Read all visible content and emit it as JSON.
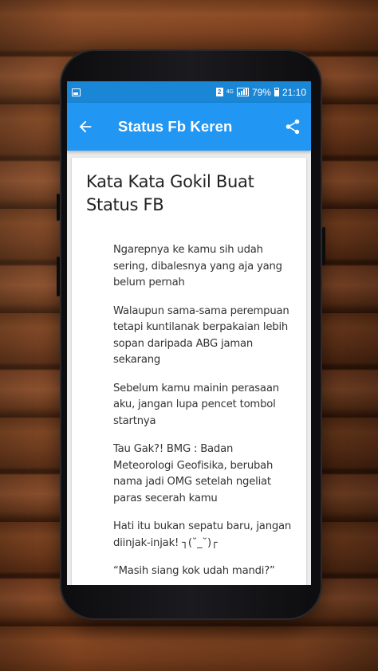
{
  "status_bar": {
    "gallery_icon": "image-icon",
    "sim_label": "2",
    "network_label": "4G",
    "battery_percent": "79%",
    "time": "21:10"
  },
  "app_bar": {
    "title": "Status Fb Keren",
    "back_icon": "arrow-back-icon",
    "share_icon": "share-icon"
  },
  "article": {
    "title": "Kata Kata Gokil Buat Status FB",
    "paragraphs": [
      "Ngarepnya ke kamu sih udah sering, dibalesnya yang aja yang belum pernah",
      "Walaupun sama-sama perempuan tetapi kuntilanak berpakaian lebih sopan daripada ABG jaman sekarang",
      "Sebelum kamu mainin perasaan aku, jangan lupa pencet tombol startnya",
      "Tau Gak?! BMG : Badan Meteorologi Geofisika, berubah nama jadi OMG setelah ngeliat paras secerah kamu",
      "Hati itu bukan sepatu baru, jangan diinjak-injak! ┐(˘_˘)┌",
      "“Masih siang kok udah mandi?”"
    ]
  },
  "colors": {
    "status_bar": "#1a86d6",
    "app_bar": "#2196f3",
    "background": "#ececec"
  }
}
